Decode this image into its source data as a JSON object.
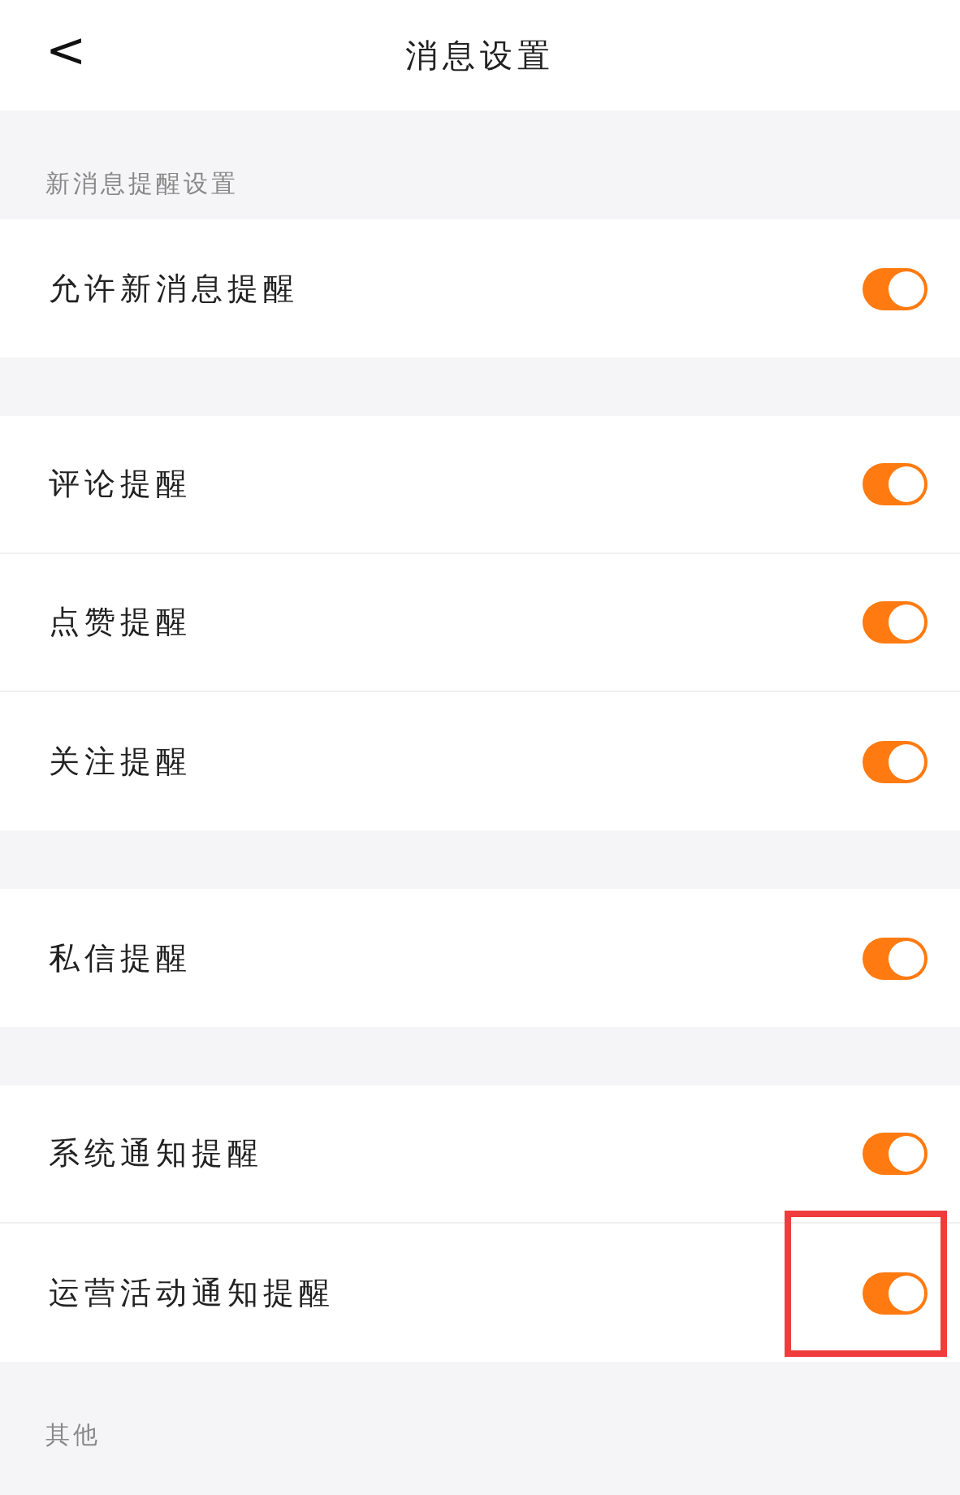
{
  "header": {
    "back": "<",
    "title": "消息设置"
  },
  "groups": [
    {
      "heading": "新消息提醒设置",
      "rows": [
        {
          "label": "允许新消息提醒",
          "on": true,
          "highlighted": false
        }
      ]
    },
    {
      "rows": [
        {
          "label": "评论提醒",
          "on": true,
          "highlighted": false
        },
        {
          "label": "点赞提醒",
          "on": true,
          "highlighted": false
        },
        {
          "label": "关注提醒",
          "on": true,
          "highlighted": false
        }
      ]
    },
    {
      "rows": [
        {
          "label": "私信提醒",
          "on": true,
          "highlighted": false
        }
      ]
    },
    {
      "rows": [
        {
          "label": "系统通知提醒",
          "on": true,
          "highlighted": false
        },
        {
          "label": "运营活动通知提醒",
          "on": true,
          "highlighted": true
        }
      ]
    },
    {
      "heading": "其他"
    }
  ]
}
